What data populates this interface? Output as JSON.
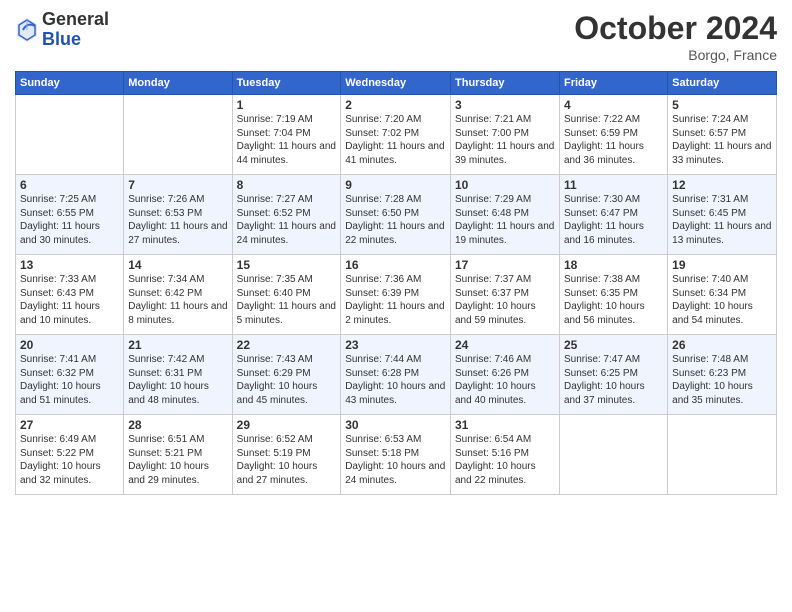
{
  "logo": {
    "general": "General",
    "blue": "Blue"
  },
  "title": "October 2024",
  "location": "Borgo, France",
  "days_header": [
    "Sunday",
    "Monday",
    "Tuesday",
    "Wednesday",
    "Thursday",
    "Friday",
    "Saturday"
  ],
  "weeks": [
    [
      {
        "num": "",
        "info": ""
      },
      {
        "num": "",
        "info": ""
      },
      {
        "num": "1",
        "info": "Sunrise: 7:19 AM\nSunset: 7:04 PM\nDaylight: 11 hours and 44 minutes."
      },
      {
        "num": "2",
        "info": "Sunrise: 7:20 AM\nSunset: 7:02 PM\nDaylight: 11 hours and 41 minutes."
      },
      {
        "num": "3",
        "info": "Sunrise: 7:21 AM\nSunset: 7:00 PM\nDaylight: 11 hours and 39 minutes."
      },
      {
        "num": "4",
        "info": "Sunrise: 7:22 AM\nSunset: 6:59 PM\nDaylight: 11 hours and 36 minutes."
      },
      {
        "num": "5",
        "info": "Sunrise: 7:24 AM\nSunset: 6:57 PM\nDaylight: 11 hours and 33 minutes."
      }
    ],
    [
      {
        "num": "6",
        "info": "Sunrise: 7:25 AM\nSunset: 6:55 PM\nDaylight: 11 hours and 30 minutes."
      },
      {
        "num": "7",
        "info": "Sunrise: 7:26 AM\nSunset: 6:53 PM\nDaylight: 11 hours and 27 minutes."
      },
      {
        "num": "8",
        "info": "Sunrise: 7:27 AM\nSunset: 6:52 PM\nDaylight: 11 hours and 24 minutes."
      },
      {
        "num": "9",
        "info": "Sunrise: 7:28 AM\nSunset: 6:50 PM\nDaylight: 11 hours and 22 minutes."
      },
      {
        "num": "10",
        "info": "Sunrise: 7:29 AM\nSunset: 6:48 PM\nDaylight: 11 hours and 19 minutes."
      },
      {
        "num": "11",
        "info": "Sunrise: 7:30 AM\nSunset: 6:47 PM\nDaylight: 11 hours and 16 minutes."
      },
      {
        "num": "12",
        "info": "Sunrise: 7:31 AM\nSunset: 6:45 PM\nDaylight: 11 hours and 13 minutes."
      }
    ],
    [
      {
        "num": "13",
        "info": "Sunrise: 7:33 AM\nSunset: 6:43 PM\nDaylight: 11 hours and 10 minutes."
      },
      {
        "num": "14",
        "info": "Sunrise: 7:34 AM\nSunset: 6:42 PM\nDaylight: 11 hours and 8 minutes."
      },
      {
        "num": "15",
        "info": "Sunrise: 7:35 AM\nSunset: 6:40 PM\nDaylight: 11 hours and 5 minutes."
      },
      {
        "num": "16",
        "info": "Sunrise: 7:36 AM\nSunset: 6:39 PM\nDaylight: 11 hours and 2 minutes."
      },
      {
        "num": "17",
        "info": "Sunrise: 7:37 AM\nSunset: 6:37 PM\nDaylight: 10 hours and 59 minutes."
      },
      {
        "num": "18",
        "info": "Sunrise: 7:38 AM\nSunset: 6:35 PM\nDaylight: 10 hours and 56 minutes."
      },
      {
        "num": "19",
        "info": "Sunrise: 7:40 AM\nSunset: 6:34 PM\nDaylight: 10 hours and 54 minutes."
      }
    ],
    [
      {
        "num": "20",
        "info": "Sunrise: 7:41 AM\nSunset: 6:32 PM\nDaylight: 10 hours and 51 minutes."
      },
      {
        "num": "21",
        "info": "Sunrise: 7:42 AM\nSunset: 6:31 PM\nDaylight: 10 hours and 48 minutes."
      },
      {
        "num": "22",
        "info": "Sunrise: 7:43 AM\nSunset: 6:29 PM\nDaylight: 10 hours and 45 minutes."
      },
      {
        "num": "23",
        "info": "Sunrise: 7:44 AM\nSunset: 6:28 PM\nDaylight: 10 hours and 43 minutes."
      },
      {
        "num": "24",
        "info": "Sunrise: 7:46 AM\nSunset: 6:26 PM\nDaylight: 10 hours and 40 minutes."
      },
      {
        "num": "25",
        "info": "Sunrise: 7:47 AM\nSunset: 6:25 PM\nDaylight: 10 hours and 37 minutes."
      },
      {
        "num": "26",
        "info": "Sunrise: 7:48 AM\nSunset: 6:23 PM\nDaylight: 10 hours and 35 minutes."
      }
    ],
    [
      {
        "num": "27",
        "info": "Sunrise: 6:49 AM\nSunset: 5:22 PM\nDaylight: 10 hours and 32 minutes."
      },
      {
        "num": "28",
        "info": "Sunrise: 6:51 AM\nSunset: 5:21 PM\nDaylight: 10 hours and 29 minutes."
      },
      {
        "num": "29",
        "info": "Sunrise: 6:52 AM\nSunset: 5:19 PM\nDaylight: 10 hours and 27 minutes."
      },
      {
        "num": "30",
        "info": "Sunrise: 6:53 AM\nSunset: 5:18 PM\nDaylight: 10 hours and 24 minutes."
      },
      {
        "num": "31",
        "info": "Sunrise: 6:54 AM\nSunset: 5:16 PM\nDaylight: 10 hours and 22 minutes."
      },
      {
        "num": "",
        "info": ""
      },
      {
        "num": "",
        "info": ""
      }
    ]
  ]
}
